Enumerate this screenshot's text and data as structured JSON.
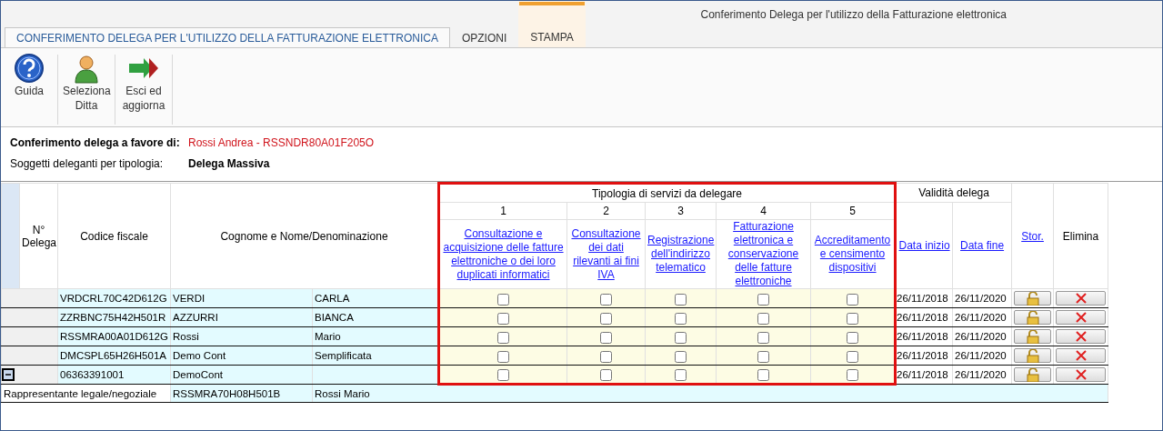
{
  "window": {
    "title": "Conferimento Delega per l'utilizzo della Fatturazione elettronica"
  },
  "tabs": [
    {
      "label": "CONFERIMENTO DELEGA PER L'UTILIZZO DELLA FATTURAZIONE ELETTRONICA",
      "selected": true,
      "kind": "normal"
    },
    {
      "label": "OPZIONI",
      "selected": false,
      "kind": "normal"
    },
    {
      "label": "STAMPA",
      "selected": false,
      "kind": "contextual"
    }
  ],
  "toolbar": [
    {
      "label": "Guida",
      "kind": "help"
    },
    {
      "label": "Seleziona Ditta",
      "kind": "user"
    },
    {
      "label": "Esci ed aggiorna",
      "kind": "exit"
    }
  ],
  "info": [
    {
      "label": "Conferimento delega a favore di:",
      "value": "Rossi Andrea - RSSNDR80A01F205O",
      "kind": "highlight"
    },
    {
      "label": "Soggetti deleganti per tipologia:",
      "value": "Delega Massiva",
      "kind": "plain"
    }
  ],
  "table": {
    "columns": {
      "number": "N° Delega",
      "codice": "Codice fiscale",
      "name": "Cognome e Nome/Denominazione",
      "services_group": "Tipologia di servizi da delegare",
      "validity_group": "Validità delega",
      "start": "Data inizio",
      "end": "Data fine",
      "history": "Stor.",
      "delete": "Elimina"
    },
    "services": [
      {
        "number": "1",
        "label": "Consultazione e acquisizione delle fatture elettroniche o dei loro duplicati informatici"
      },
      {
        "number": "2",
        "label": "Consultazione dei dati rilevanti ai fini IVA"
      },
      {
        "number": "3",
        "label": "Registrazione dell'indirizzo telematico"
      },
      {
        "number": "4",
        "label": "Fatturazione elettronica e conservazione delle fatture elettroniche"
      },
      {
        "number": "5",
        "label": "Accreditamento e censimento dispositivi"
      }
    ],
    "rows": [
      {
        "codice": "VRDCRL70C42D612G",
        "surname": "VERDI",
        "name": "CARLA",
        "services": [
          false,
          false,
          false,
          false,
          false
        ],
        "start": "26/11/2018",
        "end": "26/11/2020"
      },
      {
        "codice": "ZZRBNC75H42H501R",
        "surname": "AZZURRI",
        "name": "BIANCA",
        "services": [
          false,
          false,
          false,
          false,
          false
        ],
        "start": "26/11/2018",
        "end": "26/11/2020"
      },
      {
        "codice": "RSSMRA00A01D612G",
        "surname": "Rossi",
        "name": "Mario",
        "services": [
          false,
          false,
          false,
          false,
          false
        ],
        "start": "26/11/2018",
        "end": "26/11/2020"
      },
      {
        "codice": "DMCSPL65H26H501A",
        "surname": "Demo Cont",
        "name": "Semplificata",
        "services": [
          false,
          false,
          false,
          false,
          false
        ],
        "start": "26/11/2018",
        "end": "26/11/2020"
      },
      {
        "codice": "06363391001",
        "surname": "DemoCont",
        "services": [
          false,
          false,
          false,
          false,
          false
        ],
        "start": "26/11/2018",
        "end": "26/11/2020",
        "expanded": true,
        "children": [
          {
            "role": "Rappresentante legale/negoziale",
            "codice": "RSSMRA70H08H501B",
            "name": "Rossi Mario"
          }
        ]
      }
    ]
  }
}
